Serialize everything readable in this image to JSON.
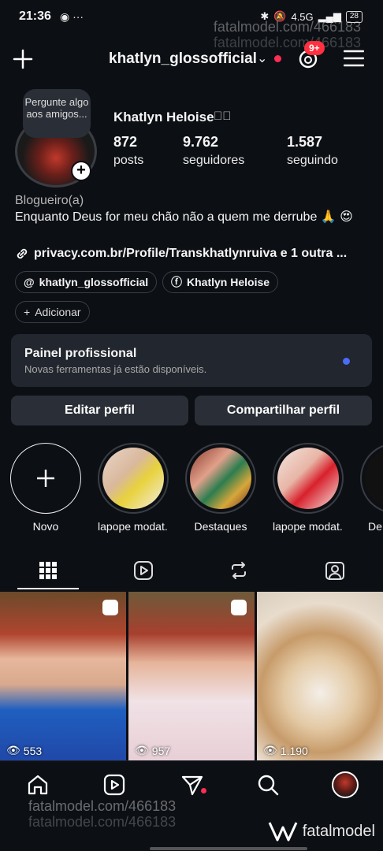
{
  "status": {
    "time": "21:36",
    "left_icons": "◉ ···",
    "network": "4.5G",
    "battery": "28"
  },
  "watermark": {
    "top_line1": "fatalmodel.com/466183",
    "top_line2": "fatalmodel.com/466183",
    "bottom_line1": "fatalmodel.com/466183",
    "bottom_line2": "fatalmodel.com/466183",
    "brand": "fatalmodel"
  },
  "header": {
    "username": "khatlyn_glossofficial",
    "notif_count": "9+"
  },
  "profile": {
    "bubble": "Pergunte algo aos amigos...",
    "name": "Khatlyn Heloise",
    "stats": [
      {
        "num": "872",
        "label": "posts"
      },
      {
        "num": "9.762",
        "label": "seguidores"
      },
      {
        "num": "1.587",
        "label": "seguindo"
      }
    ],
    "category": "Blogueiro(a)",
    "bio": "Enquanto Deus for meu chão não a quem me derrube 🙏 😍",
    "link": "privacy.com.br/Profile/Transkhatlynruiva e 1 outra ...",
    "chips": [
      {
        "label": "khatlyn_glossofficial",
        "icon": "threads-icon"
      },
      {
        "label": "Khatlyn Heloise",
        "icon": "facebook-icon"
      }
    ],
    "add_label": "Adicionar"
  },
  "panel": {
    "title": "Painel profissional",
    "subtitle": "Novas ferramentas já estão disponíveis."
  },
  "buttons": {
    "edit": "Editar perfil",
    "share": "Compartilhar perfil"
  },
  "highlights": [
    {
      "label": "Novo"
    },
    {
      "label": "lapope modat..."
    },
    {
      "label": "Destaques"
    },
    {
      "label": "lapope modat..."
    },
    {
      "label": "De"
    }
  ],
  "posts": [
    {
      "views": "553"
    },
    {
      "views": "957"
    },
    {
      "views": "1.190"
    }
  ],
  "colors": {
    "background": "#0c0f14",
    "accent_red": "#ff2d55",
    "panel": "#22262e",
    "button": "#2a2e36"
  }
}
